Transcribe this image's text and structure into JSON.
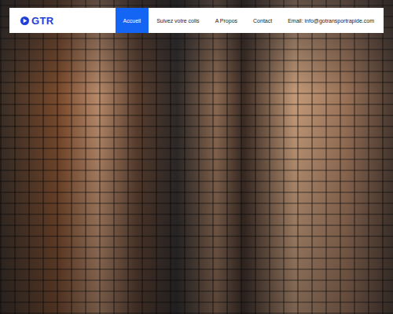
{
  "logo": {
    "text": "GTR"
  },
  "nav": {
    "items": [
      {
        "label": "Accueil",
        "selected": true
      },
      {
        "label": "Suivez votre colis",
        "selected": false
      },
      {
        "label": "A Propos",
        "selected": false
      },
      {
        "label": "Contact",
        "selected": false
      }
    ],
    "email": "Email: info@gotransportrapide.com"
  }
}
